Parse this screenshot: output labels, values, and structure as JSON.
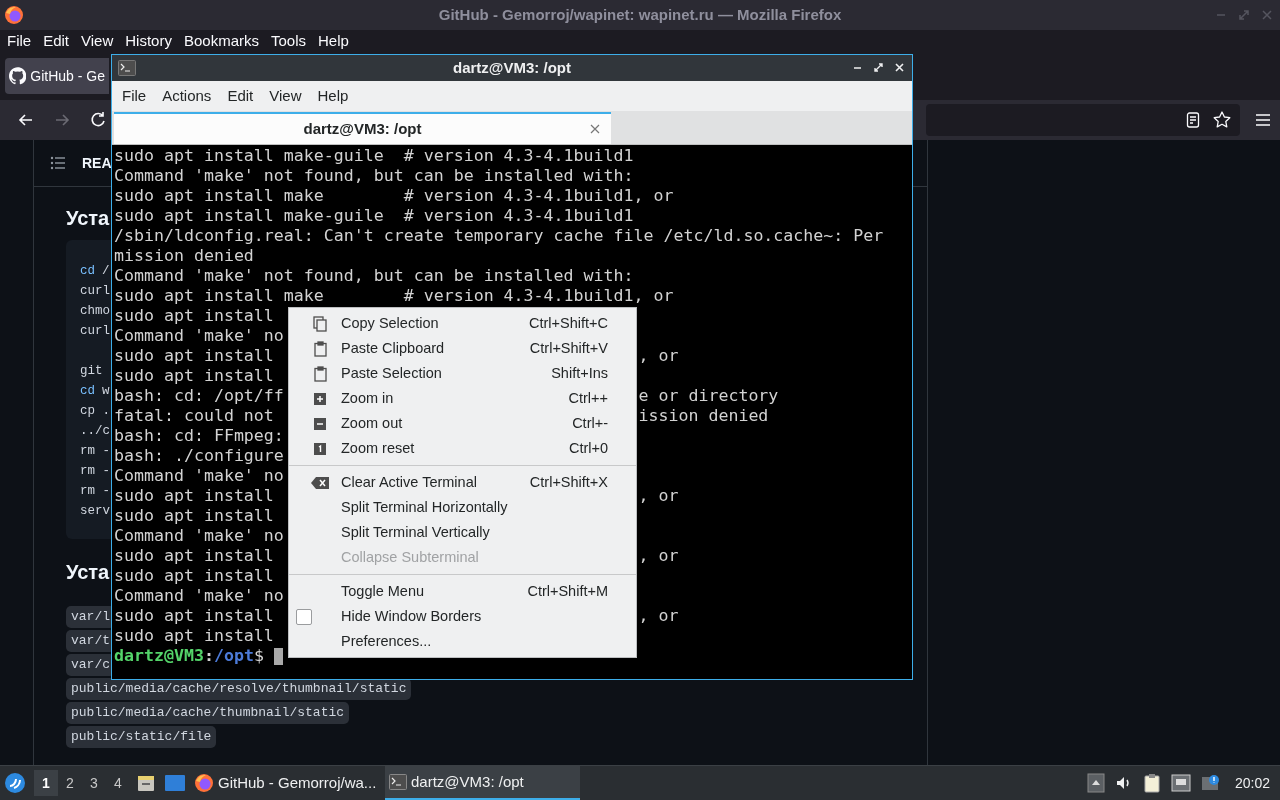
{
  "firefox": {
    "title": "GitHub - Gemorroj/wapinet: wapinet.ru — Mozilla Firefox",
    "menu": [
      "File",
      "Edit",
      "View",
      "History",
      "Bookmarks",
      "Tools",
      "Help"
    ],
    "tabs": [
      {
        "label": "GitHub - Ge",
        "selected": true
      }
    ],
    "nav_buttons": [
      {
        "kind": "back",
        "disabled": false
      },
      {
        "kind": "forward",
        "disabled": true
      },
      {
        "kind": "reload",
        "disabled": false
      }
    ]
  },
  "page": {
    "toc_label": "REA",
    "sections": [
      {
        "heading": "Уста",
        "code_lines": [
          {
            "blank_line_before": false,
            "tokens": [
              {
                "kind": "keyword",
                "text": "cd"
              },
              {
                "kind": "plain",
                "text": "/"
              }
            ]
          },
          {
            "blank_line_before": false,
            "tokens": [
              {
                "kind": "plain",
                "text": "curl"
              }
            ]
          },
          {
            "blank_line_before": false,
            "tokens": [
              {
                "kind": "plain",
                "text": "chmo"
              }
            ]
          },
          {
            "blank_line_before": false,
            "tokens": [
              {
                "kind": "plain",
                "text": "curl"
              }
            ]
          },
          {
            "blank_line_before": true,
            "tokens": [
              {
                "kind": "plain",
                "text": "git"
              }
            ]
          },
          {
            "blank_line_before": false,
            "tokens": [
              {
                "kind": "keyword",
                "text": "cd"
              },
              {
                "kind": "plain",
                "text": "w"
              }
            ]
          },
          {
            "blank_line_before": false,
            "tokens": [
              {
                "kind": "plain",
                "text": "cp ."
              }
            ]
          },
          {
            "blank_line_before": false,
            "tokens": [
              {
                "kind": "plain",
                "text": "../c"
              }
            ]
          },
          {
            "blank_line_before": false,
            "tokens": [
              {
                "kind": "plain",
                "text": "rm -"
              }
            ]
          },
          {
            "blank_line_before": false,
            "tokens": [
              {
                "kind": "plain",
                "text": "rm -"
              }
            ]
          },
          {
            "blank_line_before": false,
            "tokens": [
              {
                "kind": "plain",
                "text": "rm -"
              }
            ]
          },
          {
            "blank_line_before": false,
            "tokens": [
              {
                "kind": "plain",
                "text": "serv"
              }
            ]
          }
        ]
      },
      {
        "heading": "Уста",
        "tags": [
          "var/l",
          "var/t",
          "var/c",
          "public/media/cache/resolve/thumbnail/static",
          "public/media/cache/thumbnail/static",
          "public/static/file"
        ]
      }
    ]
  },
  "terminal": {
    "title": "dartz@VM3: /opt",
    "menu": [
      "File",
      "Actions",
      "Edit",
      "View",
      "Help"
    ],
    "tabs": [
      {
        "label": "dartz@VM3: /opt",
        "selected": true
      }
    ],
    "lines": [
      {
        "text": "sudo apt install make-guile  # version 4.3-4.1build1"
      },
      {
        "text": "Command 'make' not found, but can be installed with:"
      },
      {
        "text": "sudo apt install make        # version 4.3-4.1build1, or"
      },
      {
        "text": "sudo apt install make-guile  # version 4.3-4.1build1"
      },
      {
        "text": "/sbin/ldconfig.real: Can't create temporary cache file /etc/ld.so.cache~: Per"
      },
      {
        "text": "mission denied"
      },
      {
        "text": "Command 'make' not found, but can be installed with:"
      },
      {
        "text": "sudo apt install make        # version 4.3-4.1build1, or"
      },
      {
        "text": "sudo apt install"
      },
      {
        "text": "Command 'make' no"
      },
      {
        "text": "sudo apt install",
        "tail": ", or"
      },
      {
        "text": "sudo apt install"
      },
      {
        "text": "bash: cd: /opt/ff",
        "tail": "e or directory"
      },
      {
        "text": "fatal: could not",
        "tail": "ission denied"
      },
      {
        "text": "bash: cd: FFmpeg:"
      },
      {
        "text": "bash: ./configure"
      },
      {
        "text": "Command 'make' no"
      },
      {
        "text": "sudo apt install",
        "tail": ", or"
      },
      {
        "text": "sudo apt install"
      },
      {
        "text": "Command 'make' no"
      },
      {
        "text": "sudo apt install",
        "tail": ", or"
      },
      {
        "text": "sudo apt install"
      },
      {
        "text": "Command 'make' no"
      },
      {
        "text": "sudo apt install",
        "tail": ", or"
      },
      {
        "text": "sudo apt install"
      }
    ],
    "prompt": {
      "user": "dartz@VM3",
      "separator": ":",
      "path": "/opt",
      "symbol": "$"
    }
  },
  "context_menu": {
    "groups": [
      [
        {
          "kind": "action",
          "label": "Copy Selection",
          "shortcut": "Ctrl+Shift+C",
          "disabled": false
        },
        {
          "kind": "action",
          "label": "Paste Clipboard",
          "shortcut": "Ctrl+Shift+V",
          "disabled": false
        },
        {
          "kind": "action",
          "label": "Paste Selection",
          "shortcut": "Shift+Ins",
          "disabled": false
        },
        {
          "kind": "action",
          "label": "Zoom in",
          "shortcut": "Ctrl++",
          "disabled": false
        },
        {
          "kind": "action",
          "label": "Zoom out",
          "shortcut": "Ctrl+-",
          "disabled": false
        },
        {
          "kind": "action",
          "label": "Zoom reset",
          "shortcut": "Ctrl+0",
          "disabled": false
        }
      ],
      [
        {
          "kind": "action",
          "label": "Clear Active Terminal",
          "shortcut": "Ctrl+Shift+X",
          "disabled": false
        },
        {
          "kind": "action",
          "label": "Split Terminal Horizontally",
          "disabled": false
        },
        {
          "kind": "action",
          "label": "Split Terminal Vertically",
          "disabled": false
        },
        {
          "kind": "action",
          "label": "Collapse Subterminal",
          "disabled": true
        }
      ],
      [
        {
          "kind": "action",
          "label": "Toggle Menu",
          "shortcut": "Ctrl+Shift+M",
          "disabled": false
        },
        {
          "kind": "checkbox",
          "label": "Hide Window Borders",
          "checked": false,
          "disabled": false
        },
        {
          "kind": "action",
          "label": "Preferences...",
          "disabled": false
        }
      ]
    ]
  },
  "taskbar": {
    "workspaces": [
      {
        "label": "1",
        "selected": true
      },
      {
        "label": "2",
        "selected": false
      },
      {
        "label": "3",
        "selected": false
      },
      {
        "label": "4",
        "selected": false
      }
    ],
    "tasks": [
      {
        "label": "GitHub - Gemorroj/wa...",
        "selected": false
      },
      {
        "label": "dartz@VM3: /opt",
        "selected": true
      }
    ],
    "clock": "20:02"
  }
}
